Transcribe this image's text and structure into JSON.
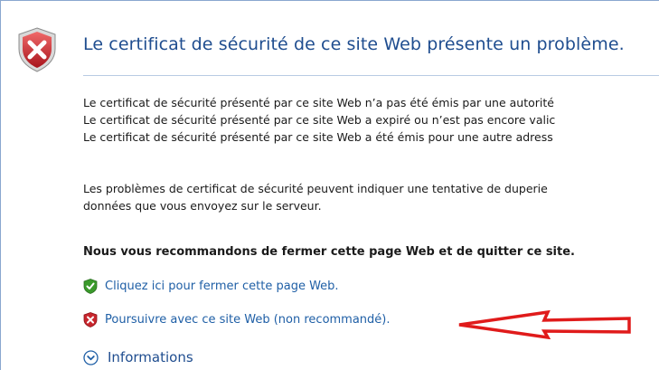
{
  "header": {
    "title": "Le certificat de sécurité de ce site Web présente un problème."
  },
  "body": {
    "reasons": [
      "Le certificat de sécurité présenté par ce site Web n’a pas été émis par une autorité",
      "Le certificat de sécurité présenté par ce site Web a expiré ou n’est pas encore valic",
      "Le certificat de sécurité présenté par ce site Web a été émis pour une autre adress"
    ],
    "warning_lines": [
      "Les problèmes de certificat de sécurité peuvent indiquer une tentative de duperie",
      "données que vous envoyez sur le serveur."
    ],
    "recommendation": "Nous vous recommandons de fermer cette page Web et de quitter ce site."
  },
  "actions": {
    "close_label": "Cliquez ici pour fermer cette page Web.",
    "continue_label": "Poursuivre avec ce site Web (non recommandé).",
    "info_label": "Informations"
  },
  "icons": {
    "big_shield": "shield-error-icon",
    "close_link": "shield-ok-icon",
    "continue_link": "shield-error-icon",
    "info": "chevron-down-circle-icon",
    "annotation": "red-arrow-icon"
  },
  "colors": {
    "title": "#1f4d8f",
    "link": "#1f5fa6",
    "error_red": "#c8262d",
    "ok_green": "#3a9a2b",
    "arrow_red": "#e01b1b"
  }
}
